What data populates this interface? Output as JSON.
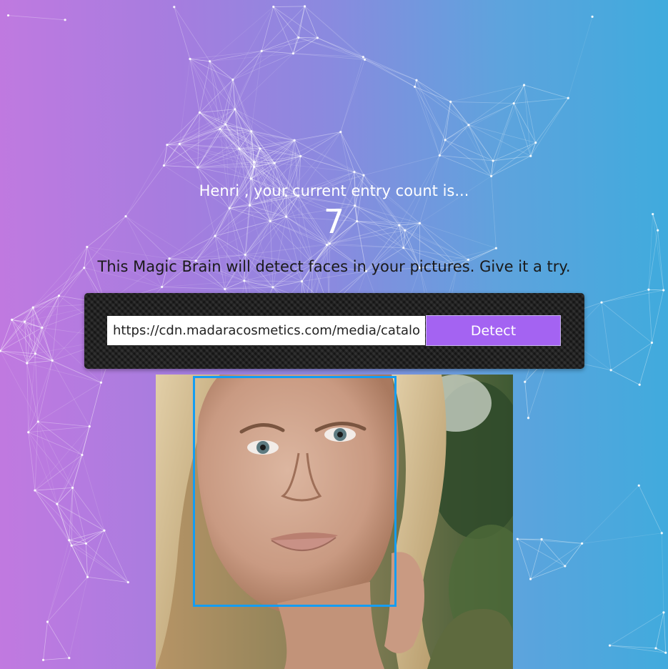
{
  "user": {
    "greeting": "Henri , your current entry count is...",
    "entry_count": "7"
  },
  "intro": {
    "text": "This Magic Brain will detect faces in your pictures. Give it a try."
  },
  "form": {
    "url_value": "https://cdn.madaracosmetics.com/media/catalog/",
    "detect_label": "Detect"
  },
  "colors": {
    "button": "#a463f2",
    "face_box": "#149df2",
    "gradient_left": "#c179e0",
    "gradient_right": "#3fabdd"
  }
}
